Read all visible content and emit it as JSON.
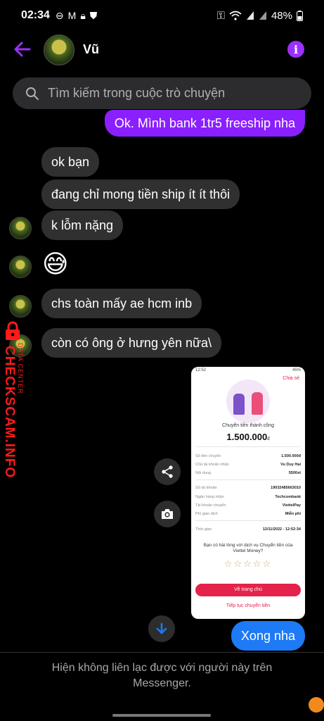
{
  "status_bar": {
    "time": "02:34",
    "battery": "48%",
    "left_icons": [
      "minus-circle-icon",
      "gmail-icon",
      "lock-icon",
      "shield-icon"
    ],
    "right_icons": [
      "key-icon",
      "wifi-icon",
      "signal-icon",
      "signal-icon",
      "battery-icon"
    ]
  },
  "header": {
    "contact_name": "Vũ",
    "accent_color": "#9b30ff"
  },
  "search": {
    "placeholder": "Tìm kiếm trong cuộc trò chuyện"
  },
  "messages": [
    {
      "sender": "me",
      "text": "Ok. Mình bank 1tr5 freeship nha",
      "color": "#8a1fff"
    },
    {
      "sender": "them",
      "text": "ok bạn"
    },
    {
      "sender": "them",
      "text": "đang chỉ mong tiền ship ít ít thôi"
    },
    {
      "sender": "them",
      "text": "k lỗm nặng"
    },
    {
      "sender": "them",
      "text": "😅"
    },
    {
      "sender": "them",
      "text": "chs toàn mấy ae hcm inb"
    },
    {
      "sender": "them",
      "text": "còn có ông ở hưng yên nữa\\"
    },
    {
      "sender": "me",
      "text": "Xong nha",
      "color": "#1e7af5"
    }
  ],
  "receipt": {
    "status_time": "12:52",
    "status_battery": "45%",
    "share_label": "Chia sẻ",
    "title": "Chuyển tiền thành công",
    "amount": "1.500.000",
    "currency": "đ",
    "rows_1": [
      {
        "label": "Số tiền chuyển",
        "value": "1.500.000đ"
      },
      {
        "label": "Chủ tài khoản nhận",
        "value": "Vu Duy Hai"
      },
      {
        "label": "Nội dung",
        "value": "5500xt"
      }
    ],
    "rows_2": [
      {
        "label": "Số tài khoản",
        "value": "19032485663010"
      },
      {
        "label": "Ngân hàng nhận",
        "value": "Techcombank"
      },
      {
        "label": "Tài khoản chuyển",
        "value": "ViettelPay"
      },
      {
        "label": "Phí giao dịch",
        "value": "Miễn phí"
      }
    ],
    "time_row": {
      "label": "Thời gian",
      "value": "12/11/2022 - 12:52:34"
    },
    "survey_question": "Bạn có hài lòng với dịch vụ Chuyển tiền của Viettel Money?",
    "stars": "☆☆☆☆☆",
    "home_button": "Về trang chủ",
    "continue_link": "Tiếp tục chuyển tiền"
  },
  "watermark": {
    "text": "CHECKSCAM.INFO",
    "sub": "DATA CENTER"
  },
  "footer": {
    "notice": "Hiện không liên lạc được với người này trên Messenger."
  }
}
